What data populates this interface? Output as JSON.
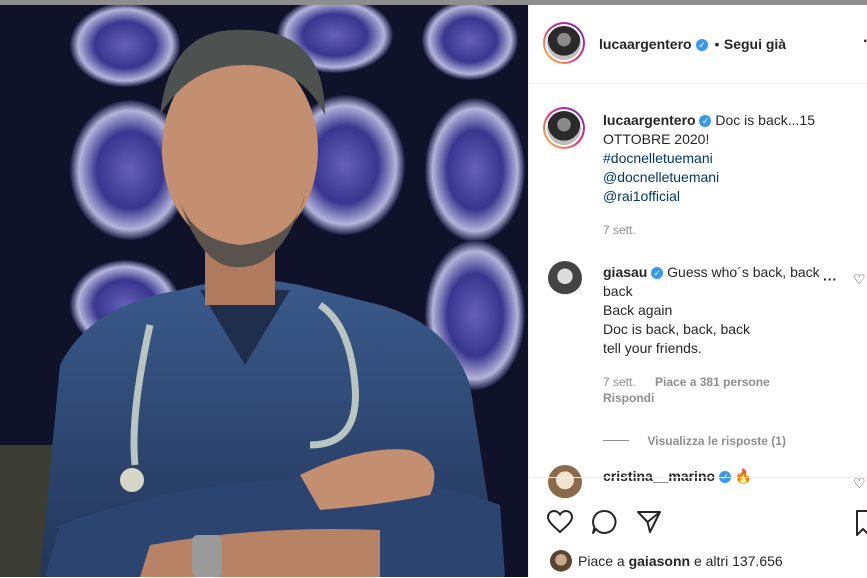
{
  "header": {
    "username": "lucaargentero",
    "separator": "•",
    "follow_label": "Segui già",
    "more_icon": "more-icon"
  },
  "caption": {
    "username": "lucaargentero",
    "text": "Doc is back...15 OTTOBRE 2020!",
    "hashtag": "#docnelletuemani",
    "mentions": [
      "@docnelletuemani",
      "@rai1official"
    ],
    "time": "7 sett."
  },
  "comments": [
    {
      "username": "giasau",
      "lines": [
        "Guess who´s back, back, back",
        "Back again",
        "Doc is back, back, back",
        "tell your friends."
      ],
      "time": "7 sett.",
      "likes": "Piace a 381 persone",
      "reply_label": "Rispondi",
      "view_replies": "Visualizza le risposte (1)"
    },
    {
      "username": "cristina__marino",
      "text": "🔥"
    }
  ],
  "actions": {
    "icons": [
      "heart-icon",
      "comment-icon",
      "share-icon",
      "bookmark-icon"
    ],
    "likes_prefix": "Piace a",
    "likes_user": "gaiasonn",
    "likes_suffix": "e altri 137.656"
  }
}
